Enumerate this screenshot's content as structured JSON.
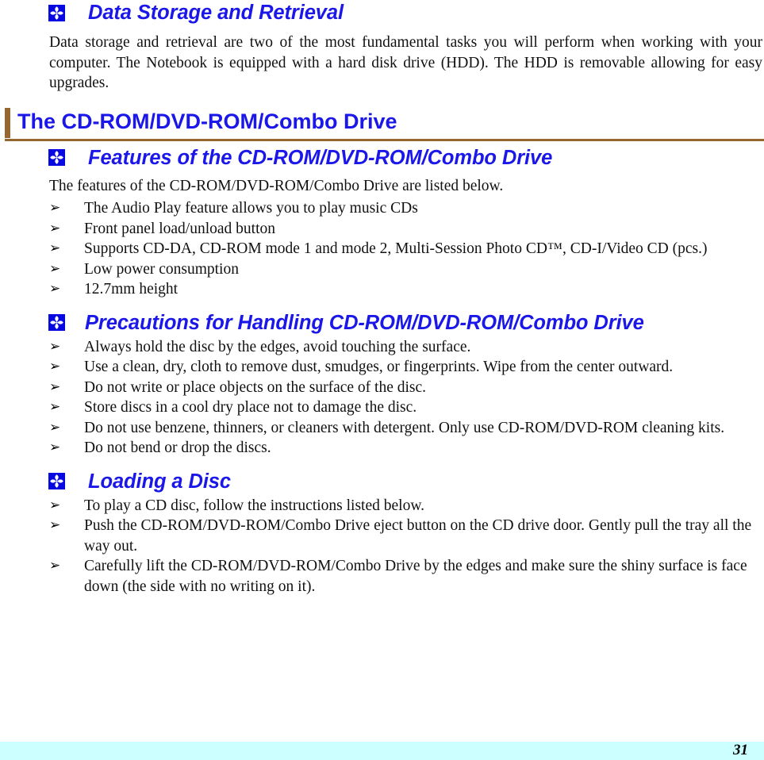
{
  "document": {
    "sections": [
      {
        "id": "data-storage",
        "heading": {
          "level": 2,
          "icon": "flower-bullet-icon",
          "text": "Data Storage and Retrieval"
        },
        "paragraph": "Data storage and retrieval are two of the most fundamental tasks you will perform when working with your computer.  The Notebook is equipped with a hard disk drive (HDD).  The HDD is removable allowing for easy upgrades."
      },
      {
        "id": "cdrom-drive",
        "heading": {
          "level": 1,
          "text": "The CD-ROM/DVD-ROM/Combo Drive"
        }
      },
      {
        "id": "features",
        "heading": {
          "level": 2,
          "icon": "flower-bullet-icon",
          "text": "Features of the CD-ROM/DVD-ROM/Combo Drive"
        },
        "paragraph": "The features of the CD-ROM/DVD-ROM/Combo Drive are listed below.",
        "bullets": [
          "The Audio Play feature allows you to play music CDs",
          "Front panel load/unload button",
          "Supports CD-DA, CD-ROM mode 1 and mode 2, Multi-Session Photo CD™, CD-I/Video CD (pcs.)",
          "Low power consumption",
          "12.7mm height"
        ]
      },
      {
        "id": "precautions",
        "heading": {
          "level": 2,
          "icon": "flower-bullet-icon",
          "text": "Precautions for Handling CD-ROM/DVD-ROM/Combo Drive"
        },
        "bullets": [
          "Always hold the disc by the edges, avoid touching the surface.",
          "Use a clean, dry, cloth to remove dust, smudges, or fingerprints.  Wipe from the center outward.",
          "Do not write or place objects on the surface of the disc.",
          "Store discs in a cool dry place not to damage the disc.",
          "Do not use benzene, thinners, or cleaners with detergent.  Only use CD-ROM/DVD-ROM cleaning kits.",
          "Do not bend or drop the discs."
        ]
      },
      {
        "id": "loading-a-disc",
        "heading": {
          "level": 2,
          "icon": "flower-bullet-icon",
          "text": "Loading a Disc"
        },
        "bullets": [
          "To play a CD disc, follow the instructions listed below.",
          "Push the CD-ROM/DVD-ROM/Combo Drive eject button on the CD drive door.  Gently pull the tray all the way out.",
          "Carefully lift the CD-ROM/DVD-ROM/Combo Drive by the edges and make sure the shiny surface is face down (the side with no writing on it)."
        ]
      }
    ],
    "bullet_glyph": "➢",
    "footer": {
      "page_number": "31"
    },
    "colors": {
      "heading_blue": "#1a17e8",
      "rule_brown": "#96672e",
      "footer_band": "#ccffff",
      "icon_blue": "#0808e0"
    }
  }
}
